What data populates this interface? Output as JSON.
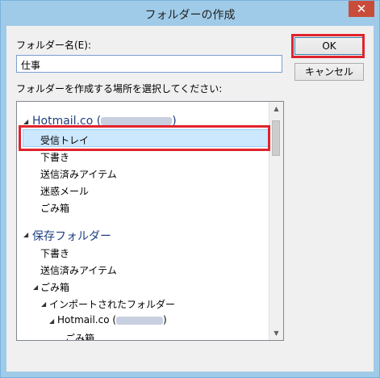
{
  "window": {
    "title": "フォルダーの作成",
    "close": "✕"
  },
  "form": {
    "name_label": "フォルダー名(E):",
    "name_value": "仕事",
    "location_label": "フォルダーを作成する場所を選択してください:"
  },
  "buttons": {
    "ok": "OK",
    "cancel": "キャンセル"
  },
  "tree": {
    "account1": "Hotmail.co (",
    "account1_close": ")",
    "items1": [
      "受信トレイ",
      "下書き",
      "送信済みアイテム",
      "迷惑メール",
      "ごみ箱"
    ],
    "saved": "保存フォルダー",
    "items2": [
      "下書き",
      "送信済みアイテム",
      "ごみ箱"
    ],
    "imported": "インポートされたフォルダー",
    "account2": "Hotmail.co (",
    "account2_close": ")",
    "last": "ごみ箱",
    "selected_index": 0
  },
  "colors": {
    "title_bg": "#9fcbe8",
    "highlight": "#e0232c",
    "account_text": "#1e3f80"
  }
}
